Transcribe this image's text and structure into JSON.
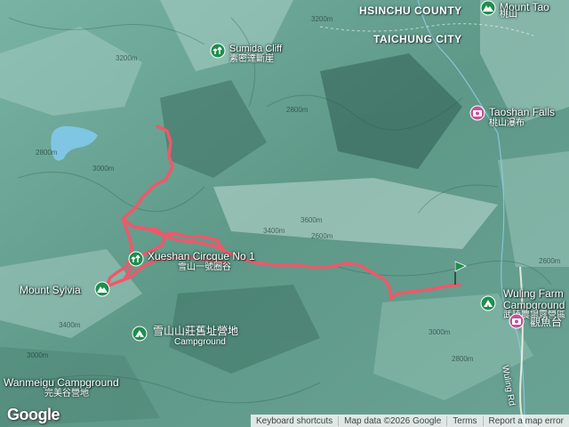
{
  "map": {
    "counties": [
      {
        "id": "hsinchu",
        "label": "HSINCHU COUNTY"
      },
      {
        "id": "taichung",
        "label": "TAICHUNG CITY"
      }
    ],
    "pois": [
      {
        "id": "mount-tao",
        "en": "Mount Tao",
        "zh": "桃山",
        "icon": "mountain-icon"
      },
      {
        "id": "sumida-cliff",
        "en": "Sumida Cliff",
        "zh": "素密達斷崖",
        "icon": "park-icon"
      },
      {
        "id": "taoshan-falls",
        "en": "Taoshan Falls",
        "zh": "桃山瀑布",
        "icon": "camera-icon"
      },
      {
        "id": "xueshan-circque",
        "en": "Xueshan Circque No 1",
        "zh": "雪山一號圈谷",
        "icon": "park-icon"
      },
      {
        "id": "mount-sylvia",
        "en": "Mount Sylvia",
        "zh": "",
        "icon": "mountain-icon"
      },
      {
        "id": "xueshan-campground",
        "en": "",
        "zh": "雪山山莊舊址營地",
        "sub": "Campground",
        "icon": "tent-icon"
      },
      {
        "id": "wuling-farm-campground",
        "en": "Wuling Farm Campground",
        "zh": "武陵農場露營區",
        "icon": "tent-icon"
      },
      {
        "id": "guanyutai",
        "en": "",
        "zh": "觀魚台",
        "icon": "camera-icon"
      },
      {
        "id": "wanmeigu-campground",
        "en": "Wanmeigu Campground",
        "zh": "完美谷營地",
        "icon": "tent-icon"
      }
    ],
    "road": {
      "label": "Wuling Rd"
    },
    "contours": [
      "2800m",
      "3000m",
      "3200m",
      "3200m",
      "2800m",
      "3600m",
      "3400m",
      "2600m",
      "3000m",
      "3400m",
      "3000m",
      "2800m",
      "2600m"
    ],
    "colors": {
      "terrain_base": "#6fa79a",
      "ridge_light": "#b9d8cf",
      "valley_dark": "#2f5e54",
      "lake": "#7fc6e4",
      "track": "#f0576a",
      "poi_green": "#1e8e4e",
      "poi_pink": "#c4539a",
      "end_flag": "#1e8e4e"
    }
  },
  "footer": {
    "logo": "Google",
    "keyboard": "Keyboard shortcuts",
    "data": "Map data ©2026 Google",
    "terms": "Terms",
    "report": "Report a map error"
  }
}
